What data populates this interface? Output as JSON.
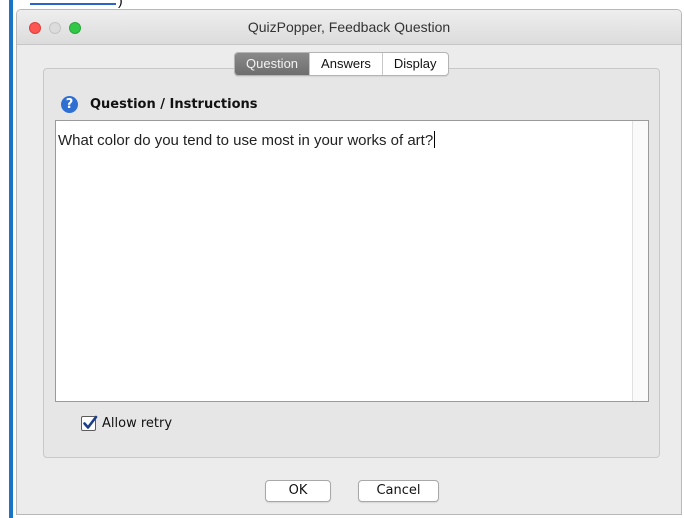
{
  "window": {
    "title": "QuizPopper, Feedback Question"
  },
  "tabs": [
    {
      "label": "Question",
      "active": true
    },
    {
      "label": "Answers",
      "active": false
    },
    {
      "label": "Display",
      "active": false
    }
  ],
  "section": {
    "icon": "help-icon",
    "icon_glyph": "?",
    "title": "Question / Instructions"
  },
  "editor": {
    "value": "What color do you tend to use most in your works of art?"
  },
  "options": {
    "allow_retry_label": "Allow retry",
    "allow_retry_checked": true
  },
  "buttons": {
    "ok_label": "OK",
    "cancel_label": "Cancel"
  },
  "page_fragment": {
    "paren": ")"
  },
  "colors": {
    "accent_rule": "#1c75c4",
    "close": "#fc5753",
    "zoom": "#33c748",
    "help_icon": "#2e6fd1",
    "active_tab": "#7a7a7a"
  }
}
